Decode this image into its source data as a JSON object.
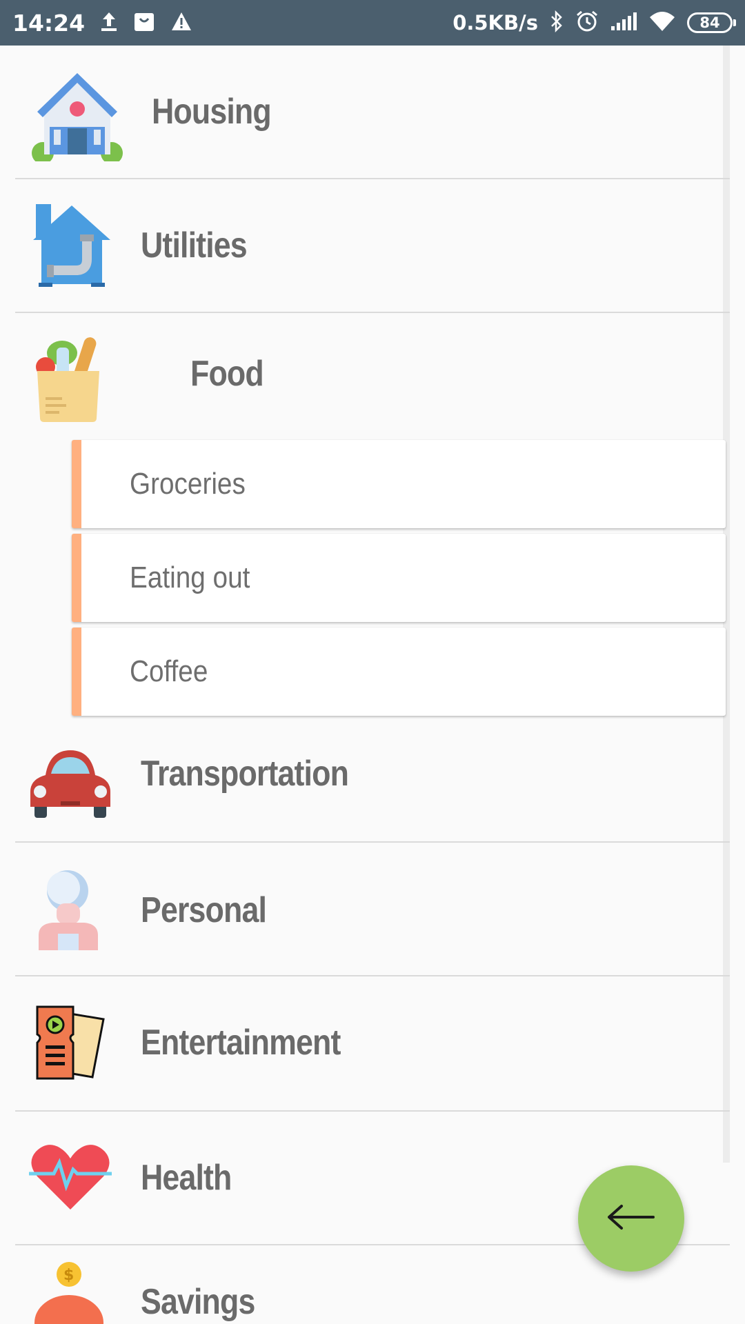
{
  "status_bar": {
    "time": "14:24",
    "network_speed": "0.5KB/s",
    "battery": "84"
  },
  "categories": [
    {
      "label": "Housing",
      "icon": "house-icon"
    },
    {
      "label": "Utilities",
      "icon": "pipe-house-icon"
    },
    {
      "label": "Food",
      "icon": "grocery-bag-icon",
      "expanded": true,
      "subcategories": [
        {
          "label": "Groceries"
        },
        {
          "label": "Eating out"
        },
        {
          "label": "Coffee"
        }
      ]
    },
    {
      "label": "Transportation",
      "icon": "car-icon"
    },
    {
      "label": "Personal",
      "icon": "person-icon"
    },
    {
      "label": "Entertainment",
      "icon": "ticket-icon"
    },
    {
      "label": "Health",
      "icon": "heartbeat-icon"
    },
    {
      "label": "Savings",
      "icon": "piggy-bank-icon"
    }
  ],
  "colors": {
    "status_bar": "#4b5f6e",
    "accent": "#ffb080",
    "fab": "#9ccc65",
    "label": "#6a6a6a"
  },
  "fab": {
    "icon": "arrow-left-icon"
  }
}
